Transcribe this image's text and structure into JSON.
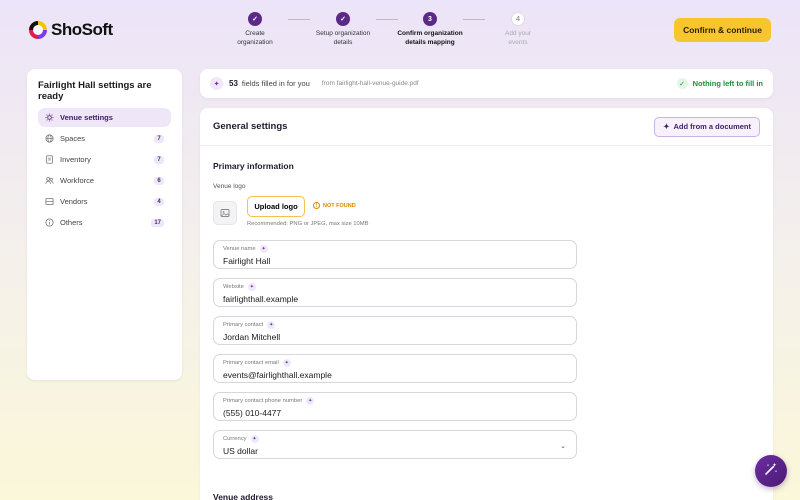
{
  "brand": {
    "name": "ShoSoft"
  },
  "stepper": {
    "steps": [
      {
        "num": "✓",
        "label_line1": "Create",
        "label_line2": "organization",
        "state": "done"
      },
      {
        "num": "✓",
        "label_line1": "Setup organization",
        "label_line2": "details",
        "state": "done"
      },
      {
        "num": "3",
        "label_line1": "Confirm organization",
        "label_line2": "details mapping",
        "state": "active"
      },
      {
        "num": "4",
        "label_line1": "Add your",
        "label_line2": "events",
        "state": "future"
      }
    ]
  },
  "header": {
    "confirm_label": "Confirm & continue"
  },
  "sidebar": {
    "title": "Fairlight Hall settings are ready",
    "items": [
      {
        "label": "Venue settings",
        "count": "",
        "icon": "sun-icon",
        "active": true
      },
      {
        "label": "Spaces",
        "count": "7",
        "icon": "globe-icon"
      },
      {
        "label": "Inventory",
        "count": "7",
        "icon": "document-icon"
      },
      {
        "label": "Workforce",
        "count": "6",
        "icon": "people-icon"
      },
      {
        "label": "Vendors",
        "count": "4",
        "icon": "box-icon"
      },
      {
        "label": "Others",
        "count": "17",
        "icon": "info-icon"
      }
    ]
  },
  "fillbar": {
    "count": "53",
    "text": "fields filled in for you",
    "source": "from fairlight-hall-venue-guide.pdf",
    "status": "Nothing left to fill in"
  },
  "main": {
    "title": "General settings",
    "add_doc_label": "Add from a document",
    "primary_title": "Primary information",
    "logo_label": "Venue logo",
    "upload_label": "Upload logo",
    "not_found": "NOT FOUND",
    "recommended": "Recommended: PNG or JPEG, max size 10MB",
    "fields": [
      {
        "label": "Venue name",
        "value": "Fairlight Hall"
      },
      {
        "label": "Website",
        "value": "fairlighthall.example"
      },
      {
        "label": "Primary contact",
        "value": "Jordan Mitchell"
      },
      {
        "label": "Primary contact email",
        "value": "events@fairlighthall.example"
      },
      {
        "label": "Primary contact phone number",
        "value": "(555) 010-4477"
      },
      {
        "label": "Currency",
        "value": "US dollar"
      }
    ],
    "address_title": "Venue address"
  },
  "colors": {
    "accent": "#5b2a86",
    "cta": "#f7c62f",
    "success": "#1e8e3e",
    "warning": "#d48806"
  }
}
